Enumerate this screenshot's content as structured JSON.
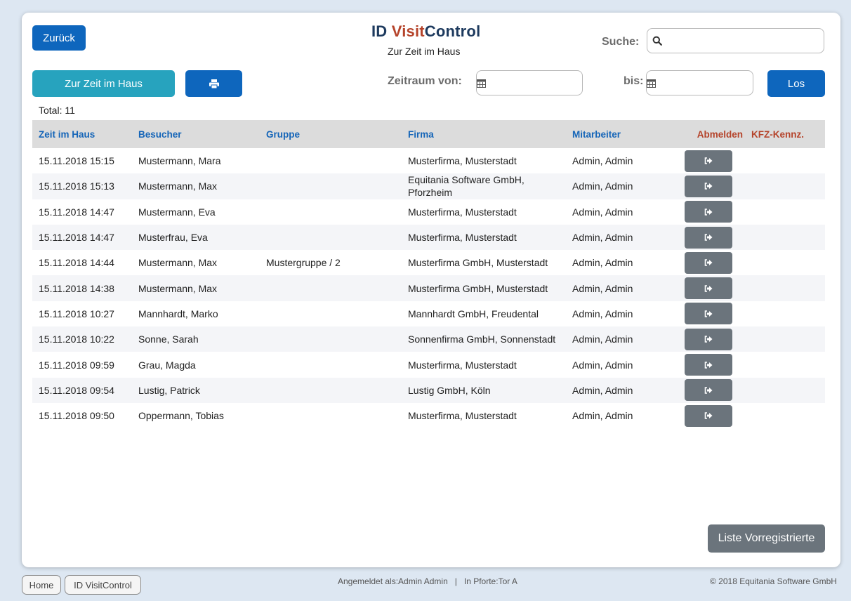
{
  "header": {
    "back_label": "Zurück",
    "logo_id": "ID ",
    "logo_visit": "Visit",
    "logo_control": "Control",
    "subtitle": "Zur Zeit im Haus",
    "search_label": "Suche:",
    "search_value": ""
  },
  "toolbar": {
    "presence_label": "Zur Zeit im Haus",
    "print_icon": "printer-icon",
    "from_label": "Zeitraum von:",
    "from_value": "",
    "to_label": "bis:",
    "to_value": "",
    "go_label": "Los"
  },
  "total": "Total: 11",
  "table": {
    "headers": [
      "Zeit im Haus",
      "Besucher",
      "Gruppe",
      "Firma",
      "Mitarbeiter",
      "Abmelden",
      "KFZ-Kennz."
    ],
    "rows": [
      {
        "time": "15.11.2018 15:15",
        "visitor": "Mustermann, Mara",
        "group": "",
        "company": "Musterfirma, Musterstadt",
        "employee": "Admin, Admin",
        "plate": ""
      },
      {
        "time": "15.11.2018 15:13",
        "visitor": "Mustermann, Max",
        "group": "",
        "company": "Equitania Software GmbH, Pforzheim",
        "employee": "Admin, Admin",
        "plate": ""
      },
      {
        "time": "15.11.2018 14:47",
        "visitor": "Mustermann, Eva",
        "group": "",
        "company": "Musterfirma, Musterstadt",
        "employee": "Admin, Admin",
        "plate": ""
      },
      {
        "time": "15.11.2018 14:47",
        "visitor": "Musterfrau, Eva",
        "group": "",
        "company": "Musterfirma, Musterstadt",
        "employee": "Admin, Admin",
        "plate": ""
      },
      {
        "time": "15.11.2018 14:44",
        "visitor": "Mustermann, Max",
        "group": "Mustergruppe / 2",
        "company": "Musterfirma GmbH, Musterstadt",
        "employee": "Admin, Admin",
        "plate": ""
      },
      {
        "time": "15.11.2018 14:38",
        "visitor": "Mustermann, Max",
        "group": "",
        "company": "Musterfirma GmbH, Musterstadt",
        "employee": "Admin, Admin",
        "plate": ""
      },
      {
        "time": "15.11.2018 10:27",
        "visitor": "Mannhardt, Marko",
        "group": "",
        "company": "Mannhardt GmbH, Freudental",
        "employee": "Admin, Admin",
        "plate": ""
      },
      {
        "time": "15.11.2018 10:22",
        "visitor": "Sonne, Sarah",
        "group": "",
        "company": "Sonnenfirma GmbH, Sonnenstadt",
        "employee": "Admin, Admin",
        "plate": ""
      },
      {
        "time": "15.11.2018 09:59",
        "visitor": "Grau, Magda",
        "group": "",
        "company": "Musterfirma, Musterstadt",
        "employee": "Admin, Admin",
        "plate": ""
      },
      {
        "time": "15.11.2018 09:54",
        "visitor": "Lustig, Patrick",
        "group": "",
        "company": "Lustig GmbH, Köln",
        "employee": "Admin, Admin",
        "plate": ""
      },
      {
        "time": "15.11.2018 09:50",
        "visitor": "Oppermann, Tobias",
        "group": "",
        "company": "Musterfirma, Musterstadt",
        "employee": "Admin, Admin",
        "plate": ""
      }
    ]
  },
  "prereg_label": "Liste Vorregistrierte",
  "footer": {
    "home_label": "Home",
    "app_label": "ID VisitControl",
    "login_info": "Angemeldet als:Admin Admin   |   In Pforte:Tor A",
    "copyright": "© 2018 Equitania Software GmbH"
  },
  "colors": {
    "primary": "#0e66bd",
    "teal": "#27a3be",
    "logout_button": "#6b747c",
    "header_link": "#1565b8",
    "accent_red": "#b5432a"
  }
}
